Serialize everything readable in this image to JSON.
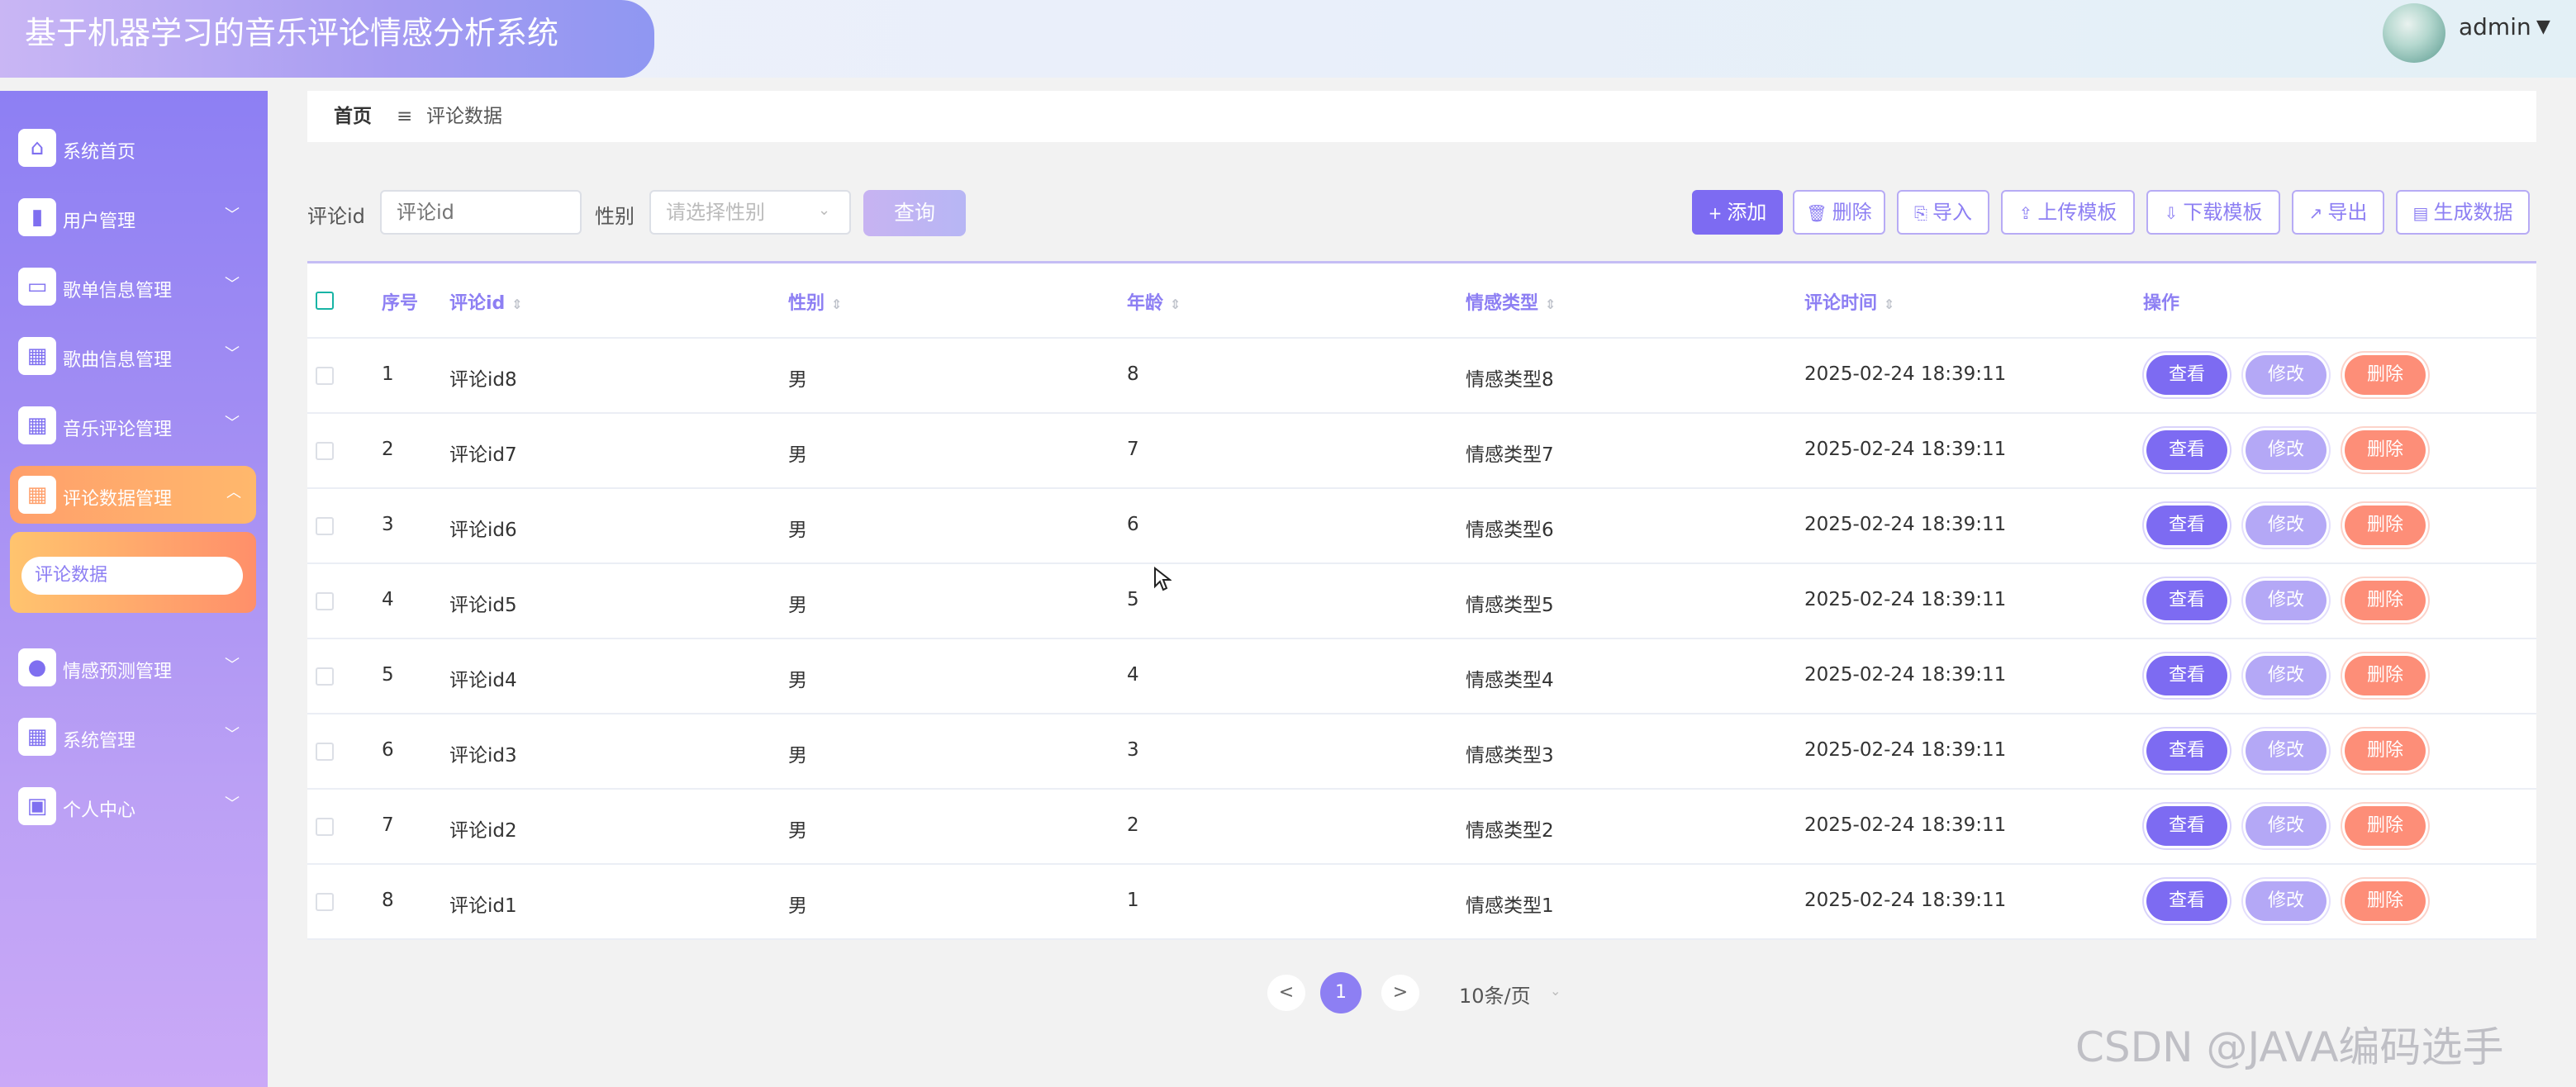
{
  "header": {
    "title": "基于机器学习的音乐评论情感分析系统",
    "user": "admin"
  },
  "sidebar": {
    "items": [
      {
        "label": "系统首页",
        "icon": "home-icon",
        "glyph": "⌂"
      },
      {
        "label": "用户管理",
        "icon": "book-icon",
        "glyph": "▮"
      },
      {
        "label": "歌单信息管理",
        "icon": "monitor-icon",
        "glyph": "▭"
      },
      {
        "label": "歌曲信息管理",
        "icon": "grid-icon",
        "glyph": "▦"
      },
      {
        "label": "音乐评论管理",
        "icon": "grid-icon",
        "glyph": "▦"
      },
      {
        "label": "评论数据管理",
        "icon": "grid-icon",
        "glyph": "▦"
      },
      {
        "label": "情感预测管理",
        "icon": "person-icon",
        "glyph": "●"
      },
      {
        "label": "系统管理",
        "icon": "grid-icon",
        "glyph": "▦"
      },
      {
        "label": "个人中心",
        "icon": "wallet-icon",
        "glyph": "▣"
      }
    ],
    "submenu": {
      "label": "评论数据"
    }
  },
  "breadcrumb": {
    "home": "首页",
    "sep": "≡",
    "current": "评论数据"
  },
  "search": {
    "id_label": "评论id",
    "id_placeholder": "评论id",
    "gender_label": "性别",
    "gender_placeholder": "请选择性别",
    "query": "查询"
  },
  "toolbar": {
    "add": "添加",
    "delete": "删除",
    "import": "导入",
    "upload_template": "上传模板",
    "download_template": "下载模板",
    "export": "导出",
    "generate": "生成数据"
  },
  "table": {
    "columns": [
      "序号",
      "评论id",
      "性别",
      "年龄",
      "情感类型",
      "评论时间",
      "操作"
    ],
    "rows": [
      {
        "idx": "1",
        "cid": "评论id8",
        "gender": "男",
        "age": "8",
        "emotion": "情感类型8",
        "time": "2025-02-24 18:39:11"
      },
      {
        "idx": "2",
        "cid": "评论id7",
        "gender": "男",
        "age": "7",
        "emotion": "情感类型7",
        "time": "2025-02-24 18:39:11"
      },
      {
        "idx": "3",
        "cid": "评论id6",
        "gender": "男",
        "age": "6",
        "emotion": "情感类型6",
        "time": "2025-02-24 18:39:11"
      },
      {
        "idx": "4",
        "cid": "评论id5",
        "gender": "男",
        "age": "5",
        "emotion": "情感类型5",
        "time": "2025-02-24 18:39:11"
      },
      {
        "idx": "5",
        "cid": "评论id4",
        "gender": "男",
        "age": "4",
        "emotion": "情感类型4",
        "time": "2025-02-24 18:39:11"
      },
      {
        "idx": "6",
        "cid": "评论id3",
        "gender": "男",
        "age": "3",
        "emotion": "情感类型3",
        "time": "2025-02-24 18:39:11"
      },
      {
        "idx": "7",
        "cid": "评论id2",
        "gender": "男",
        "age": "2",
        "emotion": "情感类型2",
        "time": "2025-02-24 18:39:11"
      },
      {
        "idx": "8",
        "cid": "评论id1",
        "gender": "男",
        "age": "1",
        "emotion": "情感类型1",
        "time": "2025-02-24 18:39:11"
      }
    ],
    "actions": {
      "view": "查看",
      "edit": "修改",
      "delete": "删除"
    }
  },
  "pagination": {
    "prev": "<",
    "current": "1",
    "next": ">",
    "page_size": "10条/页"
  },
  "watermark": "CSDN @JAVA编码选手"
}
